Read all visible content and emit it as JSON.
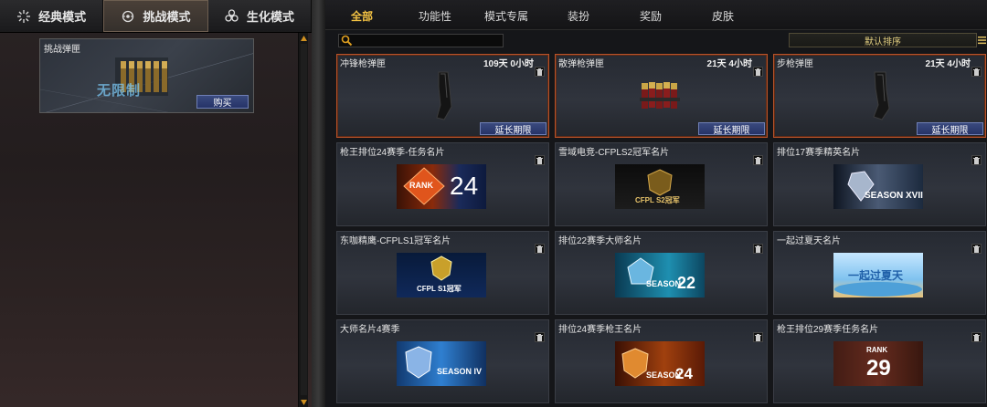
{
  "mode_tabs": [
    {
      "label": "经典模式",
      "icon": "crosshair-burst-icon"
    },
    {
      "label": "挑战模式",
      "icon": "target-icon",
      "active": true
    },
    {
      "label": "生化模式",
      "icon": "biohazard-icon"
    }
  ],
  "challenge_item": {
    "name": "挑战弹匣",
    "logo_text": "无限制",
    "buy_label": "购买"
  },
  "category_tabs": [
    {
      "label": "全部",
      "active": true
    },
    {
      "label": "功能性"
    },
    {
      "label": "模式专属"
    },
    {
      "label": "装扮"
    },
    {
      "label": "奖励"
    },
    {
      "label": "皮肤"
    }
  ],
  "search": {
    "placeholder": ""
  },
  "sort": {
    "label": "默认排序"
  },
  "items": [
    {
      "title": "冲锋枪弹匣",
      "time": "109天 0小时",
      "extend": "延长期限",
      "featured": true,
      "visual": "smg-mag"
    },
    {
      "title": "散弹枪弹匣",
      "time": "21天 4小时",
      "extend": "延长期限",
      "featured": true,
      "visual": "shells"
    },
    {
      "title": "步枪弹匣",
      "time": "21天 4小时",
      "extend": "延长期限",
      "featured": true,
      "visual": "rifle-mag"
    },
    {
      "title": "枪王排位24赛季-任务名片",
      "visual": "rank24",
      "banner_text": [
        "RANK",
        "24"
      ]
    },
    {
      "title": "雪域电竞-CFPLS2冠军名片",
      "visual": "cfpls2",
      "banner_text": [
        "CFPL S2冠军"
      ]
    },
    {
      "title": "排位17赛季精英名片",
      "visual": "season17",
      "banner_text": [
        "SEASON XVII"
      ]
    },
    {
      "title": "东咖精鹰-CFPLS1冠军名片",
      "visual": "cfpls1",
      "banner_text": [
        "CFPL S1冠军"
      ]
    },
    {
      "title": "排位22赛季大师名片",
      "visual": "season22",
      "banner_text": [
        "SEASON",
        "22"
      ]
    },
    {
      "title": "一起过夏天名片",
      "visual": "summer",
      "banner_text": [
        "一起过夏天"
      ]
    },
    {
      "title": "大师名片4赛季",
      "visual": "seasoniv",
      "banner_text": [
        "SEASON IV"
      ]
    },
    {
      "title": "排位24赛季枪王名片",
      "visual": "season24",
      "banner_text": [
        "SEASON",
        "24"
      ]
    },
    {
      "title": "枪王排位29赛季任务名片",
      "visual": "rank29",
      "banner_text": [
        "RANK",
        "29"
      ]
    }
  ],
  "colors": {
    "accent": "#f3c243",
    "featured_border": "#b8532a",
    "button": "#2f3d73"
  }
}
